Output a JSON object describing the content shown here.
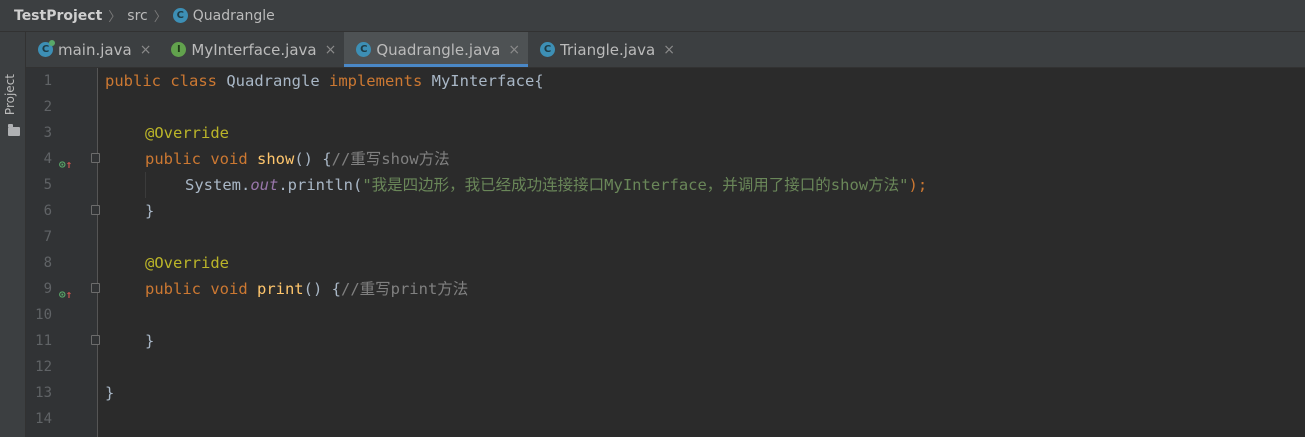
{
  "breadcrumb": {
    "project": "TestProject",
    "folder": "src",
    "file": "Quadrangle",
    "file_icon": "class-icon"
  },
  "side_panel": {
    "label": "Project"
  },
  "tabs": [
    {
      "label": "main.java",
      "icon": "C",
      "close": "×",
      "active": false
    },
    {
      "label": "MyInterface.java",
      "icon": "I",
      "close": "×",
      "active": false
    },
    {
      "label": "Quadrangle.java",
      "icon": "C",
      "close": "×",
      "active": true
    },
    {
      "label": "Triangle.java",
      "icon": "C",
      "close": "×",
      "active": false
    }
  ],
  "line_numbers": [
    "1",
    "2",
    "3",
    "4",
    "5",
    "6",
    "7",
    "8",
    "9",
    "10",
    "11",
    "12",
    "13",
    "14"
  ],
  "code": {
    "l1": {
      "kw1": "public class ",
      "name": "Quadrangle ",
      "kw2": "implements ",
      "iface": "MyInterface{"
    },
    "l3": {
      "ann": "@Override"
    },
    "l4": {
      "kw": "public void ",
      "fn": "show",
      "rest": "() {",
      "cmt": "//重写show方法"
    },
    "l5": {
      "a": "System.",
      "fld": "out",
      "b": ".println(",
      "str": "\"我是四边形，我已经成功连接接口MyInterface，并调用了接口的show方法\"",
      "end": ");"
    },
    "l6": {
      "text": "}"
    },
    "l8": {
      "ann": "@Override"
    },
    "l9": {
      "kw": "public void ",
      "fn": "print",
      "rest": "() {",
      "cmt": "//重写print方法"
    },
    "l11": {
      "text": "}"
    },
    "l13": {
      "text": "}"
    }
  },
  "colors": {
    "keyword": "#cc7832",
    "annotation": "#bbb529",
    "method": "#ffc66d",
    "comment": "#808080",
    "string": "#6a8759",
    "field": "#9876aa",
    "tab_underline": "#4a88c7"
  }
}
